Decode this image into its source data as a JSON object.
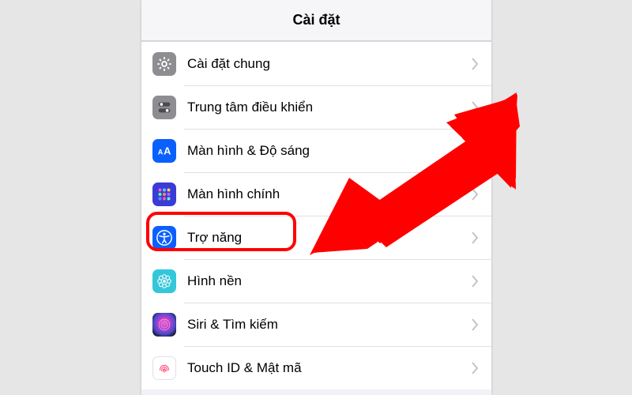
{
  "header": {
    "title": "Cài đặt"
  },
  "rows": [
    {
      "id": "general",
      "label": "Cài đặt chung",
      "icon": "gear-icon"
    },
    {
      "id": "control-center",
      "label": "Trung tâm điều khiển",
      "icon": "control-center-icon"
    },
    {
      "id": "display",
      "label": "Màn hình & Độ sáng",
      "icon": "display-brightness-icon"
    },
    {
      "id": "home-screen",
      "label": "Màn hình chính",
      "icon": "home-screen-icon"
    },
    {
      "id": "accessibility",
      "label": "Trợ năng",
      "icon": "accessibility-icon",
      "highlighted": true
    },
    {
      "id": "wallpaper",
      "label": "Hình nền",
      "icon": "wallpaper-icon"
    },
    {
      "id": "siri",
      "label": "Siri & Tìm kiếm",
      "icon": "siri-icon"
    },
    {
      "id": "touch-id",
      "label": "Touch ID & Mật mã",
      "icon": "touch-id-icon"
    }
  ],
  "annotation": {
    "highlight_target": "accessibility",
    "arrow_color": "#ff0000"
  }
}
